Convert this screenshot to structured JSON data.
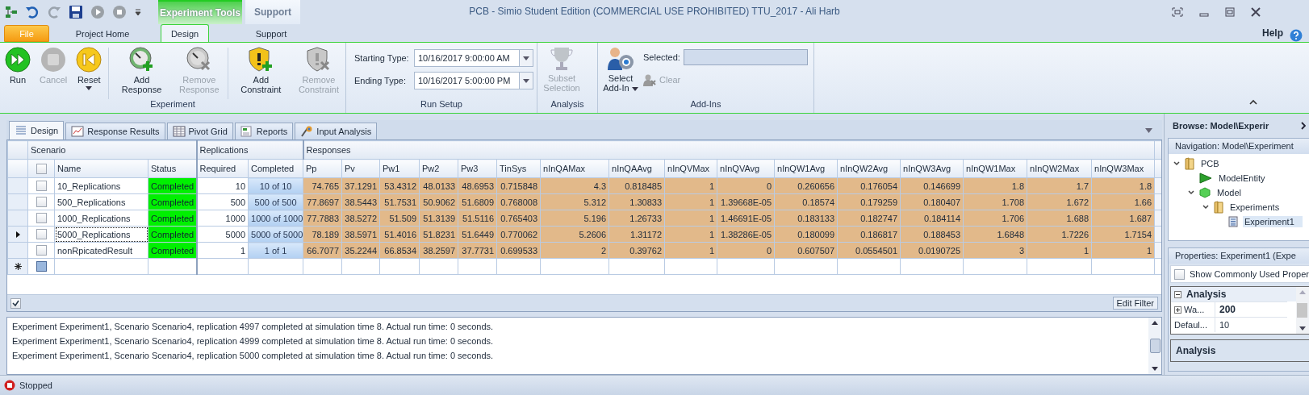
{
  "quick_access": [
    {
      "kind": "app",
      "disabled": false
    },
    {
      "kind": "undo",
      "disabled": false
    },
    {
      "kind": "redo",
      "disabled": true
    },
    {
      "kind": "save",
      "disabled": false
    },
    {
      "kind": "run",
      "disabled": true
    },
    {
      "kind": "stop",
      "disabled": true
    },
    {
      "kind": "customize",
      "disabled": false
    }
  ],
  "contextual_tabs": [
    {
      "label": "Experiment Tools",
      "kind": "experiment"
    },
    {
      "label": "Support",
      "kind": "support"
    }
  ],
  "window": {
    "title": "PCB - Simio Student Edition (COMMERCIAL USE PROHIBITED) TTU_2017 - Ali Harb"
  },
  "ribbon_tabs": [
    {
      "label": "File",
      "kind": "file",
      "selected": false
    },
    {
      "label": "Project Home",
      "kind": "plain",
      "selected": false
    },
    {
      "label": "Design",
      "kind": "plain",
      "selected": true
    },
    {
      "label": "Support",
      "kind": "plain",
      "selected": false
    }
  ],
  "help": {
    "label": "Help"
  },
  "ribbon": {
    "experiment": {
      "label": "Experiment",
      "buttons": [
        {
          "label": "Run",
          "kind": "run",
          "disabled": false,
          "dropdown": false
        },
        {
          "label": "Cancel",
          "kind": "cancel",
          "disabled": true,
          "dropdown": false
        },
        {
          "label": "Reset",
          "kind": "reset",
          "disabled": false,
          "dropdown": true
        },
        {
          "label": "Add Response",
          "kind": "add-response",
          "disabled": false,
          "dropdown": false
        },
        {
          "label": "Remove Response",
          "kind": "remove-response",
          "disabled": true,
          "dropdown": false
        },
        {
          "label": "Add Constraint",
          "kind": "add-constraint",
          "disabled": false,
          "dropdown": false
        },
        {
          "label": "Remove Constraint",
          "kind": "remove-constraint",
          "disabled": true,
          "dropdown": false
        }
      ]
    },
    "run_setup": {
      "label": "Run Setup",
      "fields": [
        {
          "label": "Starting Type:",
          "value": "10/16/2017 9:00:00 AM"
        },
        {
          "label": "Ending Type:",
          "value": "10/16/2017 5:00:00 PM"
        }
      ]
    },
    "analysis": {
      "label": "Analysis",
      "button": {
        "label": "Subset Selection",
        "disabled": true
      }
    },
    "add_ins": {
      "label": "Add-Ins",
      "select": {
        "label": "Select Add-In",
        "dropdown": true
      },
      "selected_label": "Selected:",
      "clear": {
        "label": "Clear",
        "disabled": true
      }
    }
  },
  "doc_tabs": [
    {
      "label": "Design",
      "kind": "design",
      "selected": true
    },
    {
      "label": "Response Results",
      "kind": "results",
      "selected": false
    },
    {
      "label": "Pivot Grid",
      "kind": "pivot",
      "selected": false
    },
    {
      "label": "Reports",
      "kind": "reports",
      "selected": false
    },
    {
      "label": "Input Analysis",
      "kind": "input",
      "selected": false
    }
  ],
  "grid": {
    "header_checkbox": {
      "checked": false
    },
    "new_row_checkbox": {
      "checked": false
    },
    "groups": [
      {
        "label": "Scenario",
        "columns": [
          "Name",
          "Status"
        ]
      },
      {
        "label": "Replications",
        "columns": [
          "Required",
          "Completed"
        ]
      },
      {
        "label": "Responses",
        "columns": [
          "Pp",
          "Pv",
          "Pw1",
          "Pw2",
          "Pw3",
          "TinSys",
          "nInQAMax",
          "nInQAAvg",
          "nInQVMax",
          "nInQVAvg",
          "nInQW1Avg",
          "nInQW2Avg",
          "nInQW3Avg",
          "nInQW1Max",
          "nInQW2Max",
          "nInQW3Max"
        ]
      }
    ],
    "rows": [
      {
        "checked": false,
        "selected": false,
        "name": "10_Replications",
        "status": "Completed",
        "required": "10",
        "completed": "10 of 10",
        "values": [
          "74.765",
          "37.1291",
          "53.4312",
          "48.0133",
          "48.6953",
          "0.715848",
          "4.3",
          "0.818485",
          "1",
          "0",
          "0.260656",
          "0.176054",
          "0.146699",
          "1.8",
          "1.7",
          "1.8"
        ]
      },
      {
        "checked": false,
        "selected": false,
        "name": "500_Replications",
        "status": "Completed",
        "required": "500",
        "completed": "500 of 500",
        "values": [
          "77.8697",
          "38.5443",
          "51.7531",
          "50.9062",
          "51.6809",
          "0.768008",
          "5.312",
          "1.30833",
          "1",
          "1.39668E-05",
          "0.18574",
          "0.179259",
          "0.180407",
          "1.708",
          "1.672",
          "1.66"
        ]
      },
      {
        "checked": false,
        "selected": false,
        "name": "1000_Replications",
        "status": "Completed",
        "required": "1000",
        "completed": "1000 of 1000",
        "values": [
          "77.7883",
          "38.5272",
          "51.509",
          "51.3139",
          "51.5116",
          "0.765403",
          "5.196",
          "1.26733",
          "1",
          "1.46691E-05",
          "0.183133",
          "0.182747",
          "0.184114",
          "1.706",
          "1.688",
          "1.687"
        ]
      },
      {
        "checked": false,
        "selected": true,
        "name": "5000_Replications",
        "status": "Completed",
        "required": "5000",
        "completed": "5000 of 5000",
        "values": [
          "78.189",
          "38.5971",
          "51.4016",
          "51.8231",
          "51.6449",
          "0.770062",
          "5.2606",
          "1.31172",
          "1",
          "1.38286E-05",
          "0.180099",
          "0.186817",
          "0.188453",
          "1.6848",
          "1.7226",
          "1.7154"
        ]
      },
      {
        "checked": false,
        "selected": false,
        "name": "nonRpicatedResult",
        "status": "Completed",
        "required": "1",
        "completed": "1 of 1",
        "values": [
          "66.7077",
          "35.2244",
          "66.8534",
          "38.2597",
          "37.7731",
          "0.699533",
          "2",
          "0.39762",
          "1",
          "0",
          "0.607507",
          "0.0554501",
          "0.0190725",
          "3",
          "1",
          "1"
        ]
      }
    ]
  },
  "filter": {
    "checked": true,
    "button": "Edit Filter"
  },
  "log": [
    "Experiment Experiment1, Scenario Scenario4, replication 4997 completed at simulation time 8.  Actual run time: 0 seconds.",
    "Experiment Experiment1, Scenario Scenario4, replication 4999 completed at simulation time 8.  Actual run time: 0 seconds.",
    "Experiment Experiment1, Scenario Scenario4, replication 5000 completed at simulation time 8.  Actual run time: 0 seconds."
  ],
  "browse": {
    "title": "Browse: Model\\Experir"
  },
  "navigation": {
    "title": "Navigation: Model\\Experiment",
    "tree": [
      {
        "label": "PCB",
        "kind": "folder",
        "expanded": true,
        "selected": false,
        "children": [
          {
            "label": "ModelEntity",
            "kind": "entity",
            "selected": false
          },
          {
            "label": "Model",
            "kind": "model",
            "expanded": true,
            "selected": false,
            "children": [
              {
                "label": "Experiments",
                "kind": "folder",
                "expanded": true,
                "selected": false,
                "children": [
                  {
                    "label": "Experiment1",
                    "kind": "experiment",
                    "selected": true
                  }
                ]
              }
            ]
          }
        ]
      }
    ]
  },
  "properties": {
    "title": "Properties: Experiment1 (Expe",
    "show_common": {
      "label": "Show Commonly Used Proper",
      "checked": false
    },
    "category": {
      "label": "Analysis",
      "expanded": true,
      "rows": [
        {
          "kind": "group",
          "name": "Wa...",
          "value": "200",
          "expanded": false
        },
        {
          "kind": "value",
          "name": "Defaul...",
          "value": "10"
        }
      ]
    },
    "description": "Analysis"
  },
  "status_bar": {
    "label": "Stopped"
  }
}
